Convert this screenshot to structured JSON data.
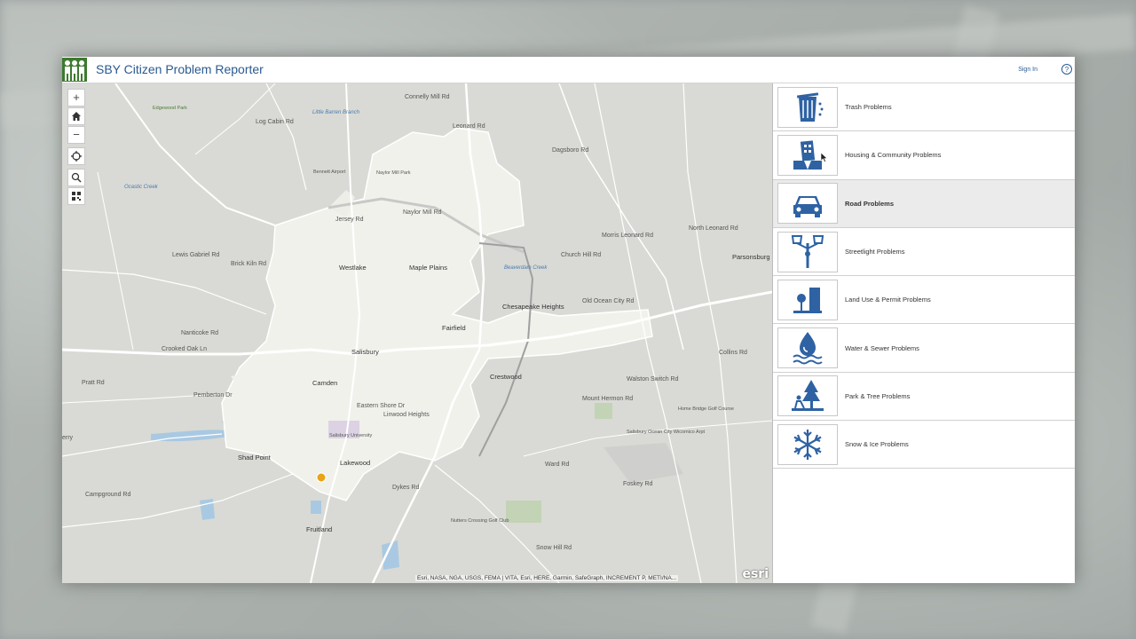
{
  "app": {
    "title": "SBY Citizen Problem Reporter",
    "sign_in": "Sign In",
    "help_icon": "?"
  },
  "colors": {
    "accent": "#2a5a91",
    "logo_green": "#3d7a2f",
    "icon_blue": "#2e62a3",
    "selected_row": "#ebebeb"
  },
  "map": {
    "tools": [
      {
        "name": "zoom-in-button",
        "glyph": "+"
      },
      {
        "name": "home-button",
        "glyph": ""
      },
      {
        "name": "zoom-out-button",
        "glyph": "−"
      },
      {
        "name": "locate-button",
        "glyph": ""
      },
      {
        "name": "search-button",
        "glyph": ""
      },
      {
        "name": "qr-code-button",
        "glyph": ""
      }
    ],
    "places": {
      "westlake": "Westlake",
      "maple_plains": "Maple Plains",
      "chesapeake_heights": "Chesapeake Heights",
      "fairfield": "Fairfield",
      "salisbury": "Salisbury",
      "camden": "Camden",
      "crestwood": "Crestwood",
      "shad_point": "Shad Point",
      "lakewood": "Lakewood",
      "fruitland": "Fruitland",
      "parsonsburg": "Parsonsburg",
      "salisbury_university": "Salisbury University",
      "little_barren_branch": "Little Barren Branch",
      "bennett_airport": "Bennett Airport",
      "naylor_mill_park": "Naylor Mill Park",
      "home_bridge_golf": "Home Bridge Golf Course",
      "ocean_city_airport": "Salisbury Ocean City Wicomico Arpt",
      "nutters_crossing": "Nutters Crossing Golf Club",
      "edgewood_park": "Edgewood Park",
      "ocastic_creek": "Ocastic Creek",
      "beaverdam_creek": "Beaverdam Creek",
      "linwood_heights": "Linwood Heights",
      "fruitland_label2": "Fruitland"
    },
    "roads": {
      "connelly_mill": "Connelly Mill Rd",
      "log_cabin": "Log Cabin Rd",
      "leonard_rd": "Leonard Rd",
      "dagsboro": "Dagsboro Rd",
      "morris_leonard": "Morris Leonard Rd",
      "north_leonard": "North Leonard Rd",
      "old_ocean_city": "Old Ocean City Rd",
      "mount_hermon": "Mount Hermon Rd",
      "pemberton": "Pemberton Dr",
      "nanticoke": "Nanticoke Rd",
      "eastern_shore": "Eastern Shore Dr",
      "walston_switch": "Walston Switch Rd",
      "pratt_rd": "Pratt Rd",
      "ward_rd": "Ward Rd",
      "snow_hill": "Snow Hill Rd",
      "dykes_rd": "Dykes Rd",
      "foskey_rd": "Foskey Rd",
      "jersey_rd": "Jersey Rd",
      "naylor_mill": "Naylor Mill Rd",
      "brick_kiln": "Brick Kiln Rd",
      "lewis_gabriel": "Lewis Gabriel Rd",
      "campground": "Campground Rd",
      "crooked_oak": "Crooked Oak Ln",
      "collins_rd": "Collins Rd",
      "church_hill": "Church Hill Rd",
      "ferry": "erry"
    },
    "attribution": "Esri, NASA, NGA, USGS, FEMA | VITA, Esri, HERE, Garmin, SafeGraph, INCREMENT P, METI/NA...",
    "esri_logo": "esri",
    "esri_powered": "POWERED BY"
  },
  "panel": {
    "categories": [
      {
        "label": "Trash Problems",
        "icon": "trash-can-icon",
        "selected": false
      },
      {
        "label": "Housing & Community Problems",
        "icon": "building-icon",
        "selected": false
      },
      {
        "label": "Road Problems",
        "icon": "car-icon",
        "selected": true
      },
      {
        "label": "Streetlight Problems",
        "icon": "streetlight-icon",
        "selected": false
      },
      {
        "label": "Land Use & Permit Problems",
        "icon": "land-use-icon",
        "selected": false
      },
      {
        "label": "Water & Sewer Problems",
        "icon": "water-drop-icon",
        "selected": false
      },
      {
        "label": "Park & Tree Problems",
        "icon": "tree-icon",
        "selected": false
      },
      {
        "label": "Snow & Ice Problems",
        "icon": "snowflake-icon",
        "selected": false
      }
    ]
  }
}
